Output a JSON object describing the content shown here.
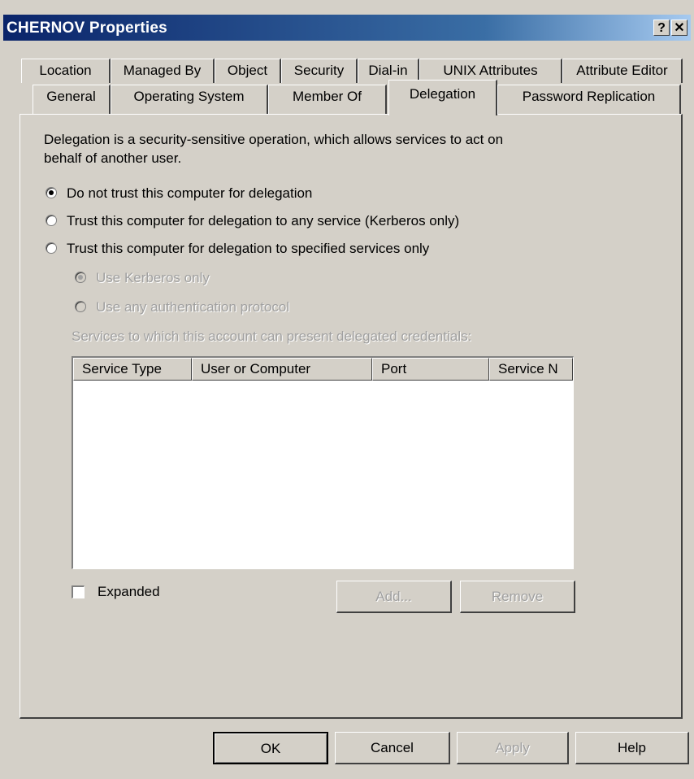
{
  "window": {
    "title": "CHERNOV Properties",
    "help_glyph": "?",
    "close_glyph": "✕"
  },
  "tabs": {
    "row1": [
      "Location",
      "Managed By",
      "Object",
      "Security",
      "Dial-in",
      "UNIX Attributes",
      "Attribute Editor"
    ],
    "row2": [
      "General",
      "Operating System",
      "Member Of",
      "Delegation",
      "Password Replication"
    ],
    "active": "Delegation"
  },
  "delegation": {
    "description_line1": "Delegation is a security-sensitive operation, which allows services to act on",
    "description_line2": "behalf of another user.",
    "options": [
      {
        "label": "Do not trust this computer for delegation",
        "selected": true
      },
      {
        "label": "Trust this computer for delegation to any service (Kerberos only)",
        "selected": false
      },
      {
        "label": "Trust this computer for delegation to specified services only",
        "selected": false
      }
    ],
    "suboptions": [
      {
        "label": "Use Kerberos only",
        "selected": true,
        "enabled": false
      },
      {
        "label": "Use any authentication protocol",
        "selected": false,
        "enabled": false
      }
    ],
    "services_label": "Services to which this account can present delegated credentials:",
    "columns": [
      "Service Type",
      "User or Computer",
      "Port",
      "Service N"
    ],
    "expanded_label": "Expanded",
    "expanded_checked": false,
    "add_label": "Add...",
    "remove_label": "Remove"
  },
  "footer": {
    "ok_label": "OK",
    "cancel_label": "Cancel",
    "apply_label": "Apply",
    "help_label": "Help"
  }
}
